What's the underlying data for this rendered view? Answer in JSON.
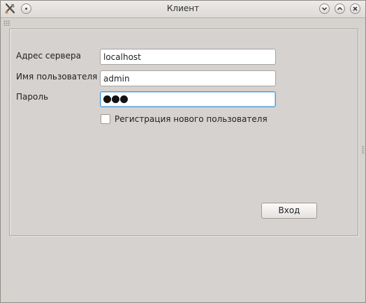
{
  "window": {
    "title": "Клиент"
  },
  "form": {
    "server_label": "Адрес сервера",
    "server_value": "localhost",
    "user_label": "Имя пользователя",
    "user_value": "admin",
    "password_label": "Пароль",
    "password_masked_char_count": 3,
    "register_label": "Регистрация нового пользователя",
    "register_checked": false,
    "login_button_label": "Вход"
  },
  "colors": {
    "window_background": "#d6d2cf",
    "focus_border": "#4c9bd6"
  },
  "icons": {
    "app": "app-tools-icon",
    "menu": "window-menu-icon",
    "minimize": "minimize-icon",
    "maximize": "maximize-icon",
    "close": "close-icon"
  }
}
